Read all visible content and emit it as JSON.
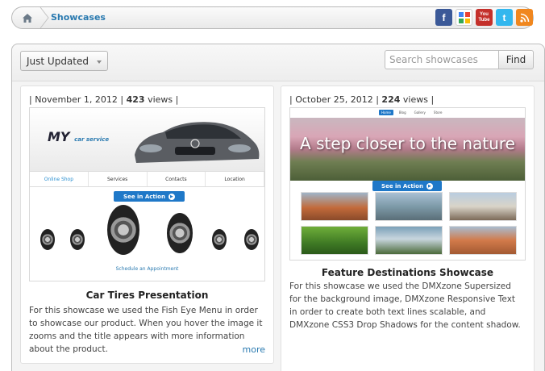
{
  "breadcrumb": {
    "home_icon": "home-icon",
    "current": "Showcases"
  },
  "social": [
    {
      "name": "facebook-icon",
      "glyph": "f",
      "color": "#3b5998"
    },
    {
      "name": "google-icon",
      "glyph": "g",
      "color": "#4285f4"
    },
    {
      "name": "youtube-icon",
      "glyph": "You Tube",
      "color": "#c4302b"
    },
    {
      "name": "twitter-icon",
      "glyph": "t",
      "color": "#33b7ee"
    },
    {
      "name": "rss-icon",
      "glyph": ")",
      "color": "#f0871f"
    }
  ],
  "toolbar": {
    "sort_label": "Just Updated",
    "search_placeholder": "Search showcases",
    "find_label": "Find"
  },
  "cards": [
    {
      "date": "November 1, 2012",
      "views": "423",
      "views_label": "views",
      "title": "Car Tires Presentation",
      "description": "For this showcase we used the Fish Eye Menu in order to showcase our product. When you hover the image it zooms and the title appears with more information about the product.",
      "more_label": "more",
      "shot": {
        "logo": "MY",
        "logo_sub": "car service",
        "nav": [
          "Online Shop",
          "Services",
          "Contacts",
          "Location"
        ],
        "cta": "See in Action",
        "foot": "Schedule an Appointment"
      }
    },
    {
      "date": "October 25, 2012",
      "views": "224",
      "views_label": "views",
      "title": "Feature Destinations Showcase",
      "description": "For this showcase we used the DMXzone Supersized for the background image, DMXzone Responsive Text in order to create both text lines scalable, and DMXzone CSS3 Drop Shadows for the content shadow.",
      "shot": {
        "menu": [
          "Home",
          "Blog",
          "Gallery",
          "Store"
        ],
        "headline": "A step closer to the nature",
        "cta": "See in Action"
      }
    }
  ],
  "colors": {
    "link": "#2a7ab0",
    "cta": "#1f78c8"
  }
}
